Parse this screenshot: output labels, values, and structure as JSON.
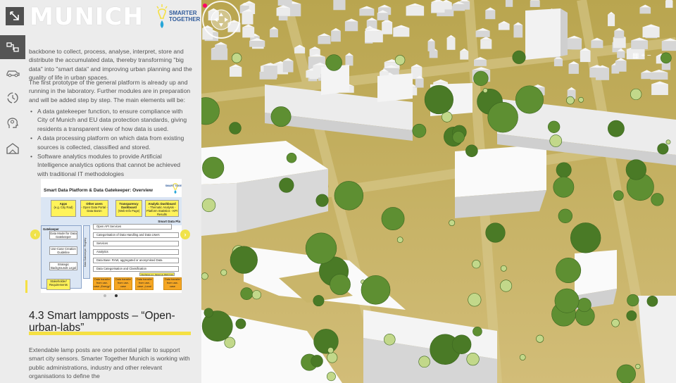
{
  "header": {
    "city_title": "MUNICH",
    "logo_line1": "SMARTER",
    "logo_line2": "TOGETHER"
  },
  "sidebar": {
    "items": [
      {
        "name": "collapse",
        "icon": "arrow-diagonal-icon"
      },
      {
        "name": "platform",
        "icon": "network-icon"
      },
      {
        "name": "mobility",
        "icon": "car-icon"
      },
      {
        "name": "cycle",
        "icon": "recycle-icon"
      },
      {
        "name": "ideas",
        "icon": "head-gear-icon"
      },
      {
        "name": "housing",
        "icon": "house-icon"
      }
    ]
  },
  "content": {
    "para1": "backbone to collect, process, analyse, interpret, store and distribute the accumulated data, thereby transforming \"big data\" into \"smart data\" and improving urban planning and the quality of life in urban spaces.",
    "para2": "The first prototype of the general platform is already up and running in the laboratory. Further modules are in preparation and will be added step by step. The main elements will be:",
    "bullets": [
      "A data gatekeeper function, to ensure compliance with City of Munich and EU data protection standards, giving residents a transparent view of how data is used.",
      "A data processing platform on which data from existing sources is collected, classified and stored.",
      "Software analytics modules to provide Artificial Intelligence analytics options that cannot be achieved with traditional IT methodologies"
    ],
    "section_heading": "4.3 Smart lampposts – “Open-urban-labs”",
    "para3": "Extendable lamp posts are one potential pillar to support smart city sensors. Smarter Together Munich is working with public administrations, industry and other relevant organisations to define the"
  },
  "infographic": {
    "title": "Smart Data Platform & Data Gatekeeper: Overview",
    "logo_text": "SMART TOGE",
    "apps": "Apps",
    "apps_sub": "(e.g. City Rad)",
    "other_users": "Other users",
    "other_users_sub": "- Open Data Portal - Data Baron",
    "transparency": "Transparency Dashboard",
    "transparency_sub": "(Web-Info Page)",
    "analytic": "Analytic Dashboard",
    "analytic_sub": "- Thematic Analysis - Platform Statistics - KPI Results",
    "platform_label": "Smart Data Pla",
    "gatekeeper": "Gatekeeper",
    "data_model": "Data Model for Data Gatekeeper",
    "use_case": "Use-Case Creation Guideline",
    "strategic": "Strategic Backgrounds Legal Framework",
    "registry": "Data Gatekeeper: Registry",
    "open_api": "Open API Services",
    "categorisation": "Categorisation of Data Handling and Data Users",
    "services": "Services",
    "analytics": "Analytics",
    "database": "Data Base: RAW, aggregated or anonymised Data",
    "classification": "Data Categorisation and Classification",
    "interface": "Interfaces e.g. based on REST Api",
    "stakeholders": "Stakeholder/ Requirements",
    "transfer1": "Data transfer from use-case „Energy“",
    "transfer2": "Data transfer from use-case „Mobility“",
    "transfer3": "Data transfer from use-case „Local Calls“",
    "transfer4": "Data transfer from use-case"
  },
  "map_controls": {
    "zoom_in": "+",
    "zoom_out": "−"
  },
  "colors": {
    "accent_yellow": "#f5e043",
    "panel_bg": "#ececec",
    "ground": "#c9b56a",
    "building": "#f4f4f4",
    "tree": "#5e8f32"
  }
}
